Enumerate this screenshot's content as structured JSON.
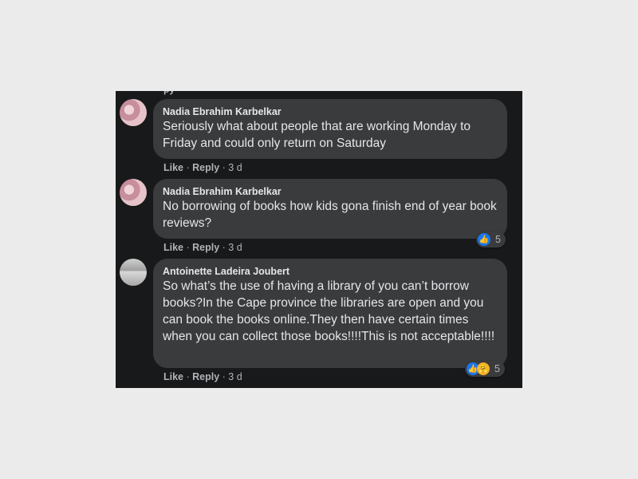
{
  "cutoff_text": "py",
  "comments": [
    {
      "author": "Nadia Ebrahim Karbelkar",
      "text": "Seriously what about people that are working Monday to Friday and could only return on Saturday",
      "actions": {
        "like": "Like",
        "reply": "Reply",
        "age": "3 d"
      },
      "avatar": "avatar-icon"
    },
    {
      "author": "Nadia Ebrahim Karbelkar",
      "text": "No borrowing of books how kids gona finish end of year book reviews?",
      "actions": {
        "like": "Like",
        "reply": "Reply",
        "age": "3 d"
      },
      "reactions": {
        "icons": [
          "like-icon"
        ],
        "count": "5"
      },
      "avatar": "avatar-icon"
    },
    {
      "author": "Antoinette Ladeira Joubert",
      "text": "So what’s the use of having a library of you can’t borrow books?In the Cape province the libraries are open and you can book the books online.They then have certain times when you can collect those books!!!!This is not acceptable!!!!",
      "actions": {
        "like": "Like",
        "reply": "Reply",
        "age": "3 d"
      },
      "reactions": {
        "icons": [
          "like-icon",
          "care-icon"
        ],
        "count": "5"
      },
      "avatar": "avatar-icon"
    }
  ],
  "separator": " · ",
  "colors": {
    "background": "#18191a",
    "bubble": "#3a3b3c",
    "text": "#e4e6eb",
    "muted": "#b0b3b8",
    "like": "#1877f2"
  }
}
